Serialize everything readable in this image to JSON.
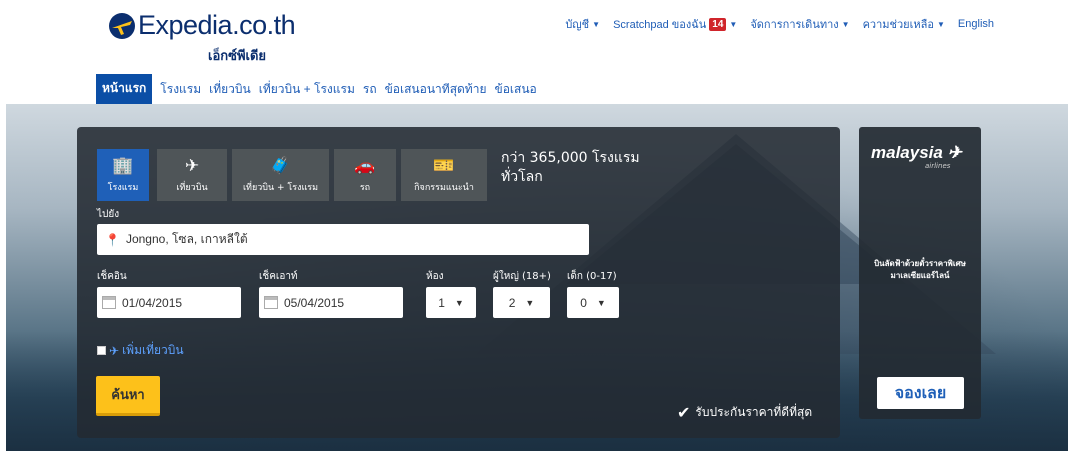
{
  "brand": {
    "name": "Expedia.co.th",
    "sub": "เอ็กซ์พีเดีย"
  },
  "topnav": {
    "account": "บัญชี",
    "scratchpad": "Scratchpad ของฉัน",
    "scratchpad_count": "14",
    "manage_trips": "จัดการการเดินทาง",
    "help": "ความช่วยเหลือ",
    "language": "English"
  },
  "mainnav": {
    "home": "หน้าแรก",
    "hotels": "โรงแรม",
    "flights": "เที่ยวบิน",
    "flight_hotel": "เที่ยวบิน + โรงแรม",
    "cars": "รถ",
    "last_minute": "ข้อเสนอนาทีสุดท้าย",
    "deals": "ข้อเสนอ"
  },
  "tabs": {
    "hotel": "โรงแรม",
    "flight": "เที่ยวบิน",
    "flight_hotel": "เที่ยวบิน + โรงแรม",
    "car": "รถ",
    "activities": "กิจกรรมแนะนำ"
  },
  "promo": {
    "line1": "กว่า 365,000 โรงแรม",
    "line2": "ทั่วโลก"
  },
  "form": {
    "destination_label": "ไปยัง",
    "destination_value": "Jongno, โซล, เกาหลีใต้",
    "checkin_label": "เช็คอิน",
    "checkin_value": "01/04/2015",
    "checkout_label": "เช็คเอาท์",
    "checkout_value": "05/04/2015",
    "rooms_label": "ห้อง",
    "rooms_value": "1",
    "adults_label": "ผู้ใหญ่ (18+)",
    "adults_value": "2",
    "children_label": "เด็ก (0-17)",
    "children_value": "0",
    "add_flight": "เพิ่มเที่ยวบิน",
    "search": "ค้นหา"
  },
  "guarantee": "รับประกันราคาที่ดีที่สุด",
  "ad": {
    "logo": "malaysia",
    "logo_sub": "airlines",
    "text": "บินลัดฟ้าด้วยตั๋วราคาพิเศษ มาเลเซียแอร์ไลน์",
    "button": "จองเลย"
  }
}
